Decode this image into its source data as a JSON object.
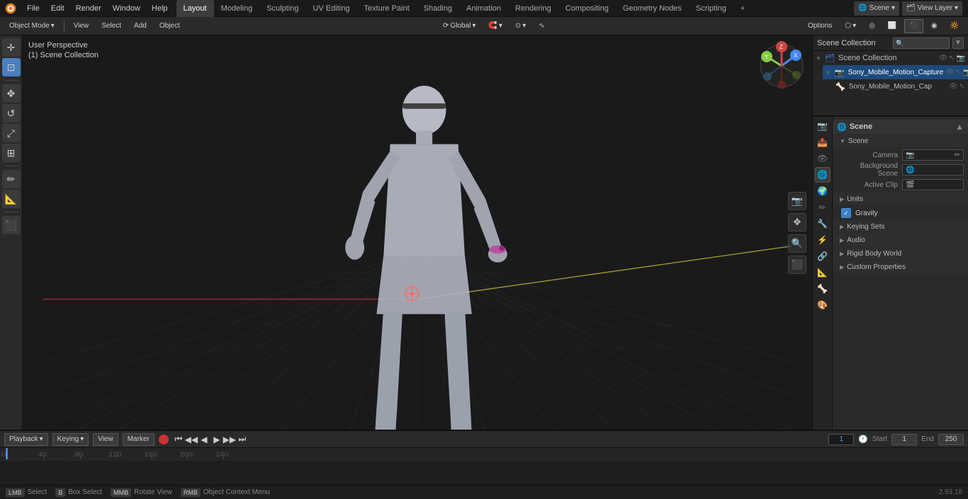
{
  "app": {
    "title": "Blender",
    "version": "2.93.18"
  },
  "menu": {
    "items": [
      "File",
      "Edit",
      "Render",
      "Window",
      "Help"
    ]
  },
  "workspace_tabs": {
    "tabs": [
      "Layout",
      "Modeling",
      "Sculpting",
      "UV Editing",
      "Texture Paint",
      "Shading",
      "Animation",
      "Rendering",
      "Compositing",
      "Geometry Nodes",
      "Scripting"
    ],
    "active": "Layout",
    "add_label": "+"
  },
  "top_right": {
    "scene_label": "Scene",
    "view_layer_label": "View Layer"
  },
  "viewport": {
    "mode_label": "Object Mode",
    "view_label": "View",
    "select_label": "Select",
    "add_label": "Add",
    "object_label": "Object",
    "perspective_label": "User Perspective",
    "collection_label": "(1) Scene Collection",
    "transform_space": "Global",
    "snap_icon": "🧲",
    "proportional_icon": "⊙"
  },
  "options_btn": "Options",
  "outliner": {
    "title": "Scene Collection",
    "items": [
      {
        "label": "Sony_Mobile_Motion_Capture",
        "depth": 1,
        "icon": "📷",
        "has_children": true
      },
      {
        "label": "Sony_Mobile_Motion_Cap",
        "depth": 2,
        "icon": "🦴"
      }
    ]
  },
  "properties": {
    "title": "Scene",
    "sections": [
      {
        "label": "Scene",
        "expanded": true,
        "subsections": [
          {
            "label": "Scene",
            "expanded": true,
            "fields": [
              {
                "label": "Camera",
                "value": "",
                "type": "camera"
              },
              {
                "label": "Background Scene",
                "value": "",
                "type": "scene"
              },
              {
                "label": "Active Clip",
                "value": "",
                "type": "clip"
              }
            ]
          }
        ]
      },
      {
        "label": "Units",
        "expanded": false
      },
      {
        "label": "Gravity",
        "expanded": false,
        "checkbox": true,
        "checked": true
      },
      {
        "label": "Keying Sets",
        "expanded": false
      },
      {
        "label": "Audio",
        "expanded": false
      },
      {
        "label": "Rigid Body World",
        "expanded": false
      },
      {
        "label": "Custom Properties",
        "expanded": false
      }
    ]
  },
  "timeline": {
    "controls": [
      "Playback",
      "Keying",
      "View",
      "Marker"
    ],
    "frame_current": "1",
    "clock_icon": "🕐",
    "start_label": "Start",
    "start_value": "1",
    "end_label": "End",
    "end_value": "250",
    "playback_btns": [
      "⏮",
      "◀◀",
      "◀",
      "▶",
      "▶▶",
      "⏭"
    ],
    "record_btn": "●",
    "ruler_marks": [
      "0",
      "40",
      "80",
      "120",
      "160",
      "200",
      "240"
    ],
    "ruler_values": [
      0,
      40,
      80,
      120,
      160,
      200,
      240
    ]
  },
  "status_bar": {
    "select_key": "Select",
    "box_select_key": "Box Select",
    "rotate_label": "Rotate View",
    "object_context_label": "Object Context Menu",
    "version": "2.93.18"
  },
  "prop_tabs": [
    {
      "icon": "📷",
      "label": "render",
      "title": "Render Properties"
    },
    {
      "icon": "📤",
      "label": "output",
      "title": "Output Properties"
    },
    {
      "icon": "👁",
      "label": "view_layer",
      "title": "View Layer"
    },
    {
      "icon": "🌐",
      "label": "scene",
      "title": "Scene Properties",
      "active": true
    },
    {
      "icon": "🌍",
      "label": "world",
      "title": "World Properties"
    },
    {
      "icon": "✏️",
      "label": "object",
      "title": "Object Properties"
    },
    {
      "icon": "✂️",
      "label": "modifier",
      "title": "Modifier Properties"
    },
    {
      "icon": "⚡",
      "label": "particles",
      "title": "Particle Properties"
    },
    {
      "icon": "🔗",
      "label": "physics",
      "title": "Physics Properties"
    },
    {
      "icon": "📐",
      "label": "constraints",
      "title": "Constraint Properties"
    },
    {
      "icon": "🦴",
      "label": "data",
      "title": "Object Data"
    },
    {
      "icon": "🎨",
      "label": "material",
      "title": "Material Properties"
    }
  ]
}
